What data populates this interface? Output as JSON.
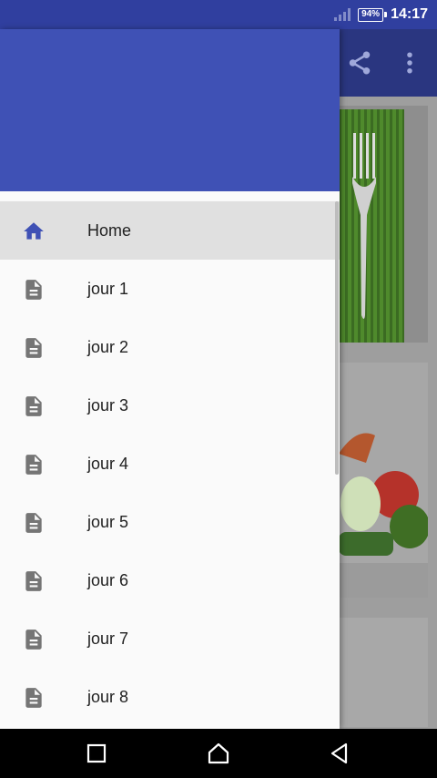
{
  "status_bar": {
    "battery": "94%",
    "time": "14:17"
  },
  "toolbar": {
    "share_icon": "share-icon",
    "overflow_icon": "more-vert-icon"
  },
  "drawer": {
    "header_color": "#3f51b5",
    "items": [
      {
        "label": "Home",
        "icon": "home-icon",
        "selected": true
      },
      {
        "label": "jour 1",
        "icon": "document-icon",
        "selected": false
      },
      {
        "label": "jour 2",
        "icon": "document-icon",
        "selected": false
      },
      {
        "label": "jour 3",
        "icon": "document-icon",
        "selected": false
      },
      {
        "label": "jour 4",
        "icon": "document-icon",
        "selected": false
      },
      {
        "label": "jour 5",
        "icon": "document-icon",
        "selected": false
      },
      {
        "label": "jour 6",
        "icon": "document-icon",
        "selected": false
      },
      {
        "label": "jour 7",
        "icon": "document-icon",
        "selected": false
      },
      {
        "label": "jour 8",
        "icon": "document-icon",
        "selected": false
      }
    ]
  },
  "nav_bar": {
    "buttons": [
      "recents-icon",
      "home-icon",
      "back-icon"
    ]
  },
  "colors": {
    "primary": "#3f51b5",
    "primary_dark": "#303f9f",
    "accent_icon": "#3f51b5",
    "doc_icon": "#757575"
  }
}
